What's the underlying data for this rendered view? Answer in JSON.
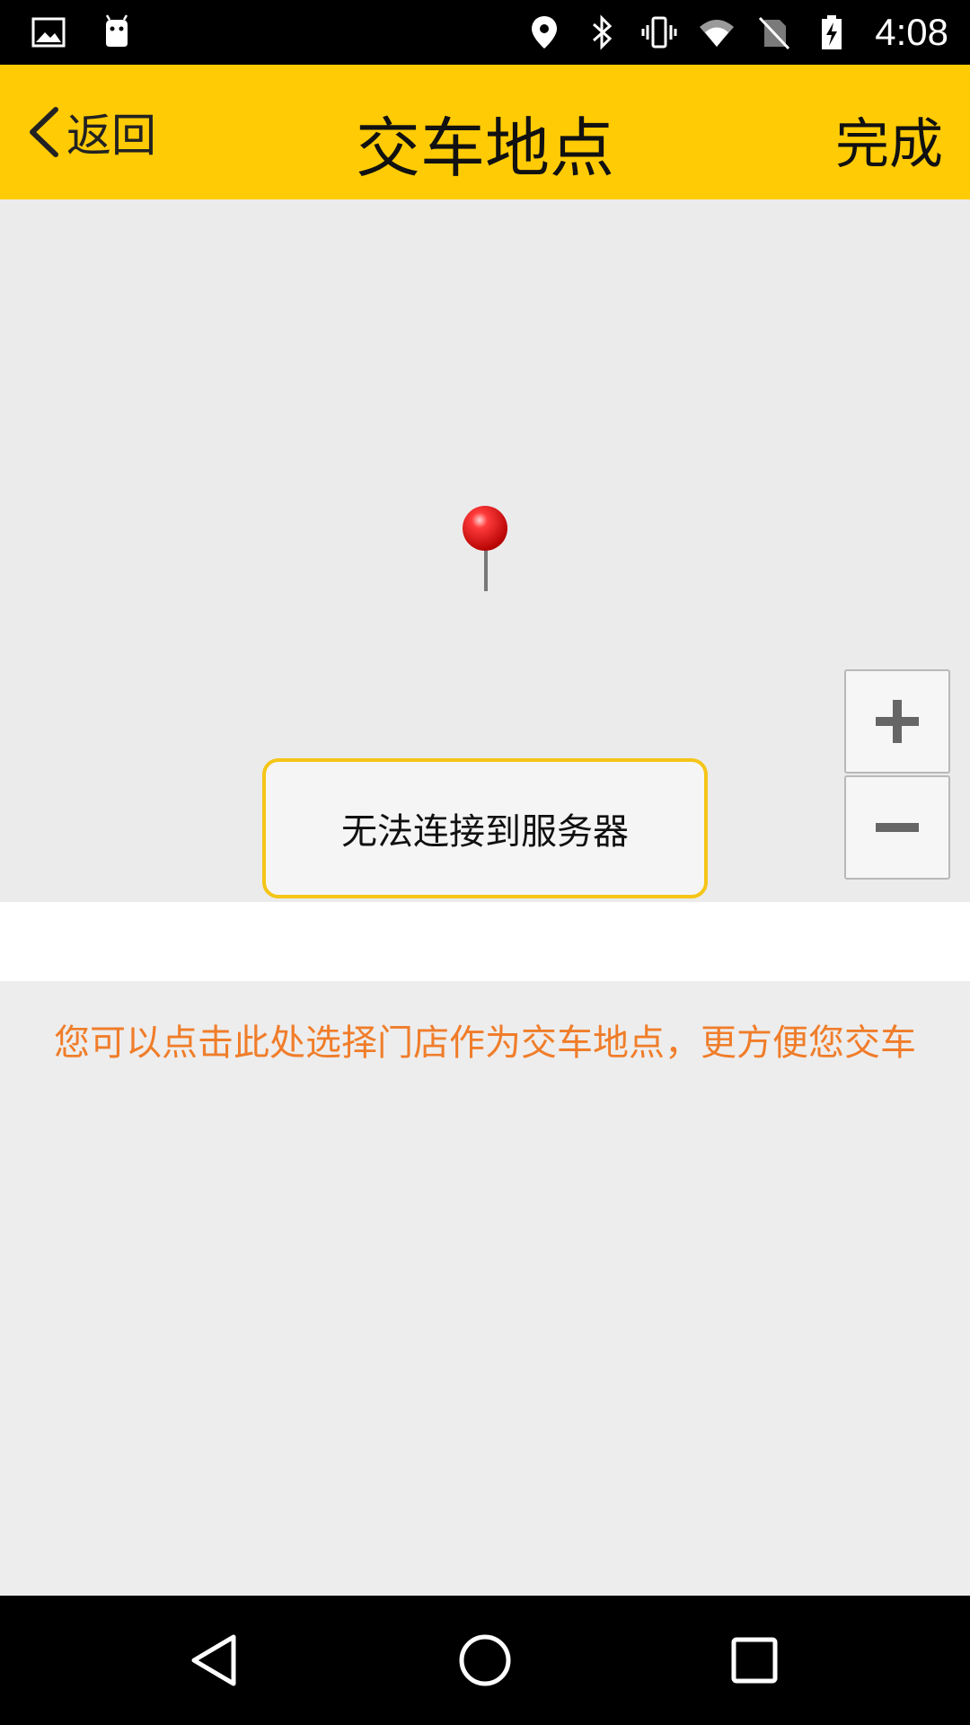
{
  "status_bar": {
    "time": "4:08",
    "left_icons": [
      "image-icon",
      "android-icon"
    ],
    "right_icons": [
      "location-icon",
      "bluetooth-icon",
      "vibrate-icon",
      "wifi-icon",
      "no-sim-icon",
      "battery-charging-icon"
    ]
  },
  "header": {
    "back_label": "返回",
    "title": "交车地点",
    "done_label": "完成"
  },
  "map": {
    "zoom_in_icon": "plus-icon",
    "zoom_out_icon": "minus-icon",
    "pin_icon": "map-pin-icon"
  },
  "toast": {
    "message": "无法连接到服务器"
  },
  "hint": {
    "text": "您可以点击此处选择门店作为交车地点，更方便您交车"
  },
  "colors": {
    "header_bg": "#ffcb05",
    "hint_text": "#f07d2a",
    "toast_border": "#f5c518"
  }
}
